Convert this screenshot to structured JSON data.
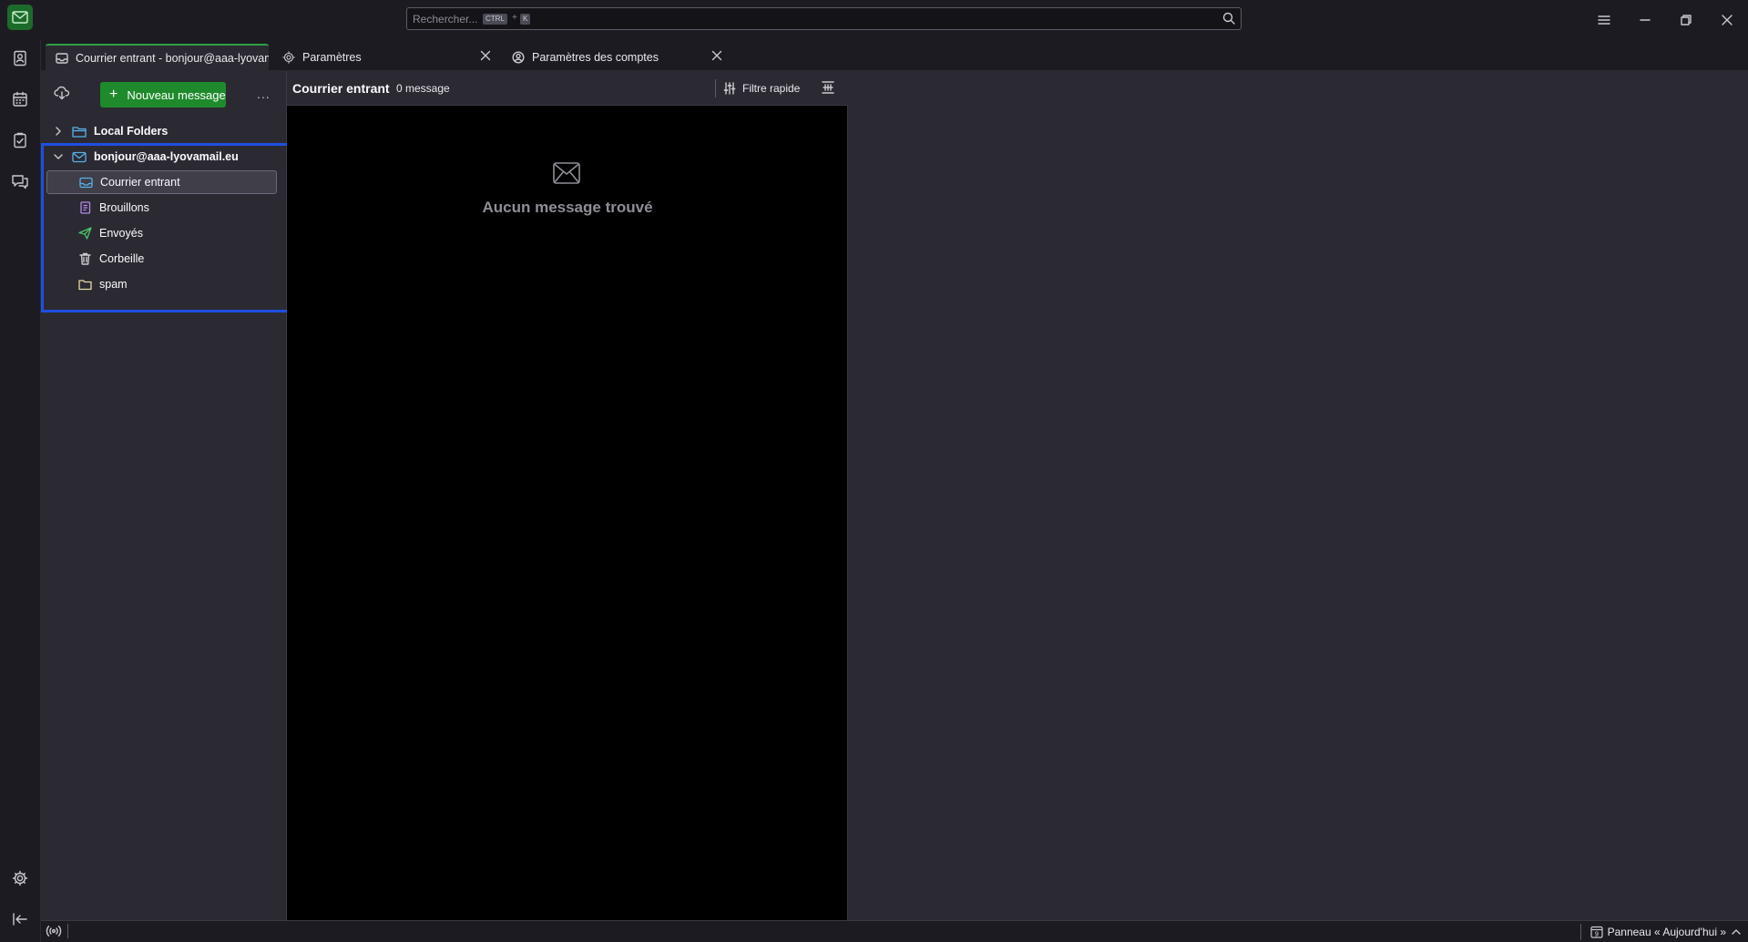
{
  "search": {
    "placeholder": "Rechercher...",
    "shortcut_mod": "CTRL",
    "shortcut_plus": "+",
    "shortcut_key": "K"
  },
  "tabs": [
    {
      "label": "Courrier entrant - bonjour@aaa-lyovamail.eu",
      "icon": "inbox-icon",
      "selected": true
    },
    {
      "label": "Paramètres",
      "icon": "gear-icon"
    },
    {
      "label": "Paramètres des comptes",
      "icon": "account-settings-icon"
    }
  ],
  "folder_pane": {
    "new_message_label": "Nouveau message",
    "more_label": "...",
    "local_folders": "Local Folders",
    "account": "bonjour@aaa-lyovamail.eu",
    "folders": [
      {
        "label": "Courrier entrant",
        "icon": "inbox-icon",
        "selected": true
      },
      {
        "label": "Brouillons",
        "icon": "drafts-icon"
      },
      {
        "label": "Envoyés",
        "icon": "sent-icon"
      },
      {
        "label": "Corbeille",
        "icon": "trash-icon"
      },
      {
        "label": "spam",
        "icon": "folder-icon"
      }
    ]
  },
  "thread_pane": {
    "title": "Courrier entrant",
    "count": "0 message",
    "quick_filter_label": "Filtre rapide",
    "empty_text": "Aucun message trouvé"
  },
  "status_bar": {
    "today_pane_label": "Panneau « Aujourd'hui »",
    "calendar_day": "9"
  },
  "colors": {
    "accent_green": "#1f8a2c",
    "highlight_border": "#1f4fe0",
    "pane_bg": "#2b2a33",
    "window_bg": "#1c1b22"
  }
}
